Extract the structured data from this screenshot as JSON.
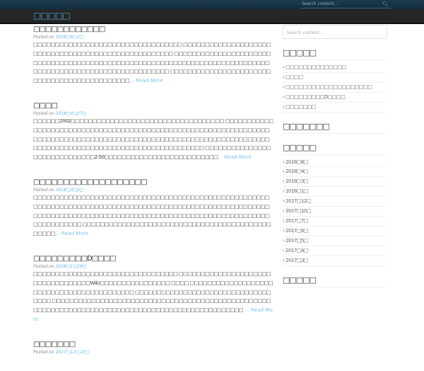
{
  "topbar": {
    "search_placeholder": "Search content...",
    "search_icon": "magnifier"
  },
  "site_title": "□□□□□",
  "posts": [
    {
      "title": "□□□□□□□□□□□□",
      "posted_on": "Posted on",
      "date": "2018□6□1□",
      "excerpt": "□□□□□□□□□□□□□□□□□□□□□□□□□□□□□□□□□□ □□□□□□□□□□□□□□□□□□□□□□□□□□□□□□□□□□□□□□□□□□□□□□□□□□□□ □□□□□□□□□□□□□□□□□□□□□□□□□□□□□□□□□□□□□□□□□□□□□□□□□□□□□□□□□□□□□□□□□□□□□□□□□□□□□□□□□□□□□□□□□□□□□□□□□□□□□□□□□□□ □□□□□□□□□□□□□□□□□□□□□□□□□□□□□□□□□□□□□□□□□□□□□",
      "read_more": "Read More"
    },
    {
      "title": "□□□□",
      "posted_on": "Posted on",
      "date": "2018□4□27□",
      "excerpt": "□□□□□□2002□□□□□□□□□□□□□□□□□□□□□□□□□□□□□□□□□□□ □□□□□□□□□□□□□□□□□□□□□□□□□□□□□□□□□□□□□□□□□□□□□□□□□□□□□□□□□□□□□□□□□□□□□□□□□□□□□□□□□□□□□□□□□□□□□□□□□□□□□□□□□□□□□□□□□□□□□□□□□□□□□□□□□□□□□□□□□□□□□□□□□□□□□□□□□□□□□□ □□□□□□□□□□□□□□□□□□□□□□□□□□□□□2:50□□□□□□□□□□□□□□□□□□□□□□□□□□",
      "read_more": "Read More"
    },
    {
      "title": "□□□□□□□□□□□□□□□□□□□",
      "posted_on": "Posted on",
      "date": "2018□3□5□",
      "excerpt": "□□□□□□□□□□□□□□□□□□□□□□□□□□□□□□□□□□□□□□□□□□□□□□□□□□□□□□□□□□□□□□□□□□□□□□□□□□□□□□□□□□□□□□□□□□□□□□□□□□□□□□□□□□□□□□□□□□□□□□□□□□□□□□□□□□□□□□□□□□□□□□□□□□□□□□□□□□□□□□□□□□□□□□□□□□□□□ □□□□□□□□□□□□□□□□□□□□□□□□□□□□□□□□□□□□□□□□□□□□□□□□",
      "read_more": "Read More"
    },
    {
      "title": "□□□□□□□□□D□□□□",
      "posted_on": "Posted on",
      "date": "2018□1□19□",
      "excerpt": "□□□□□□□□□□□□□□□□□□□□□□□□□□□□□□□□□ □□□□□□□□□□□□□□□□□□□□□□□□□□□□□□□□□□WiiU□□□□□□□□□□□□□□□□ □□□□ □□□□□□□□□□□□□□□□□□□□□□□□□□□□□□□□□□□□□□□□□□ □□□□□□□□□□□□□□□□□□□□□□□□□□□□□□□□□□□ □□□□□□□□□□□□□□□□□□□□□□□□□□□□□□□□□□□□□□□□□□□□□□□□□□□□□□□□□□□□□□□□□□□□□□□□□□□□□□□□□□□□□□□□□□□□□□□□□□ ",
      "read_more": "Read More"
    },
    {
      "title": "□□□□□□□",
      "posted_on": "Posted on",
      "date": "2017□12□10□"
    }
  ],
  "sidebar": {
    "search_placeholder": "Search content...",
    "recent_title": "□□□□□",
    "recent": [
      "□□□□□□□□□□□□□□",
      "□□□□",
      "□□□□□□□□□□□□□□□□□□□□",
      "□□□□□□□□□D□□□□",
      "□□□□□□□"
    ],
    "comments_title": "□□□□□□□",
    "archives_title": "□□□□□",
    "archives": [
      "2018□6□",
      "2018□4□",
      "2018□3□",
      "2018□1□",
      "2017□12□",
      "2017□10□",
      "2017□7□",
      "2017□6□",
      "2017□5□",
      "2017□4□",
      "2017□3□"
    ],
    "next_title": "□□□□□"
  }
}
